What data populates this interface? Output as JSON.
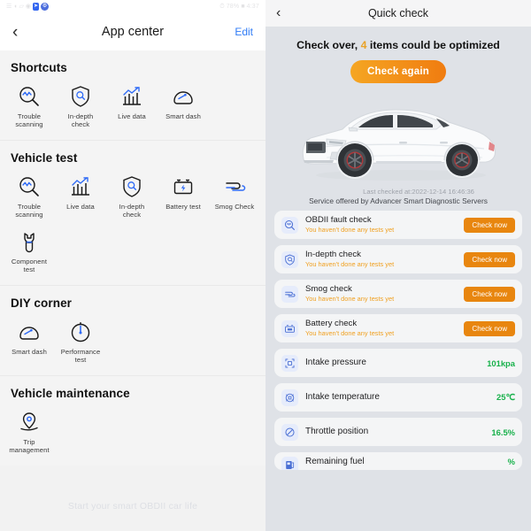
{
  "left": {
    "statusbar": {
      "left_icons": [
        "signal-icon",
        "wifi-icon",
        "bars-icon",
        "dot-icon",
        "nav-arrow-icon",
        "gear-icon"
      ],
      "right_text": "78%",
      "right_text2": "4:37"
    },
    "nav": {
      "back_icon": "chevron-left-icon",
      "title": "App center",
      "edit_label": "Edit"
    },
    "sections": [
      {
        "title": "Shortcuts",
        "items": [
          {
            "label": "Trouble\nscanning",
            "icon": "magnifier-wave-icon"
          },
          {
            "label": "In-depth\ncheck",
            "icon": "shield-magnifier-icon"
          },
          {
            "label": "Live data",
            "icon": "bar-chart-arrow-icon"
          },
          {
            "label": "Smart dash",
            "icon": "gauge-icon"
          }
        ]
      },
      {
        "title": "Vehicle test",
        "items": [
          {
            "label": "Trouble\nscanning",
            "icon": "magnifier-wave-icon"
          },
          {
            "label": "Live data",
            "icon": "bar-chart-arrow-icon"
          },
          {
            "label": "In-depth\ncheck",
            "icon": "shield-magnifier-icon"
          },
          {
            "label": "Battery test",
            "icon": "battery-bolt-icon"
          },
          {
            "label": "Smog Check",
            "icon": "smog-waves-icon"
          },
          {
            "label": "Component\ntest",
            "icon": "wrench-head-icon"
          }
        ]
      },
      {
        "title": "DIY corner",
        "items": [
          {
            "label": "Smart dash",
            "icon": "gauge-icon"
          },
          {
            "label": "Performance\ntest",
            "icon": "stopwatch-icon"
          }
        ]
      },
      {
        "title": "Vehicle maintenance",
        "items": [
          {
            "label": "Trip\nmanagement",
            "icon": "map-pin-icon"
          }
        ]
      }
    ],
    "footer_hint": "Start your smart OBDII car life"
  },
  "right": {
    "nav": {
      "back_icon": "chevron-left-icon",
      "title": "Quick check"
    },
    "summary_prefix": "Check over,",
    "summary_count": "4",
    "summary_suffix": "items could be optimized",
    "check_again_label": "Check again",
    "car_image": "white-sedan-illustration",
    "last_checked": "Last checked at:2022-12-14 16:46:36",
    "service_note": "Service offered by Advancer Smart Diagnostic Servers",
    "check_items": [
      {
        "title": "OBDII fault check",
        "subtitle": "You haven't done any tests yet",
        "button": "Check now",
        "icon": "magnifier-wave-icon"
      },
      {
        "title": "In-depth check",
        "subtitle": "You haven't done any tests yet",
        "button": "Check now",
        "icon": "shield-magnifier-icon"
      },
      {
        "title": "Smog check",
        "subtitle": "You haven't done any tests yet",
        "button": "Check now",
        "icon": "smog-waves-icon"
      },
      {
        "title": "Battery check",
        "subtitle": "You haven't done any tests yet",
        "button": "Check now",
        "icon": "battery-bolt-icon"
      }
    ],
    "data_items": [
      {
        "title": "Intake pressure",
        "value": "101kpa",
        "icon": "pressure-icon"
      },
      {
        "title": "Intake temperature",
        "value": "25℃",
        "icon": "temperature-icon"
      },
      {
        "title": "Throttle position",
        "value": "16.5%",
        "icon": "throttle-icon"
      },
      {
        "title": "Remaining fuel",
        "value": "%",
        "icon": "fuel-icon"
      }
    ]
  },
  "colors": {
    "accent_blue": "#2f6bf6",
    "accent_orange": "#e8860f",
    "value_green": "#18b14b",
    "warn_amber": "#f0a020"
  }
}
